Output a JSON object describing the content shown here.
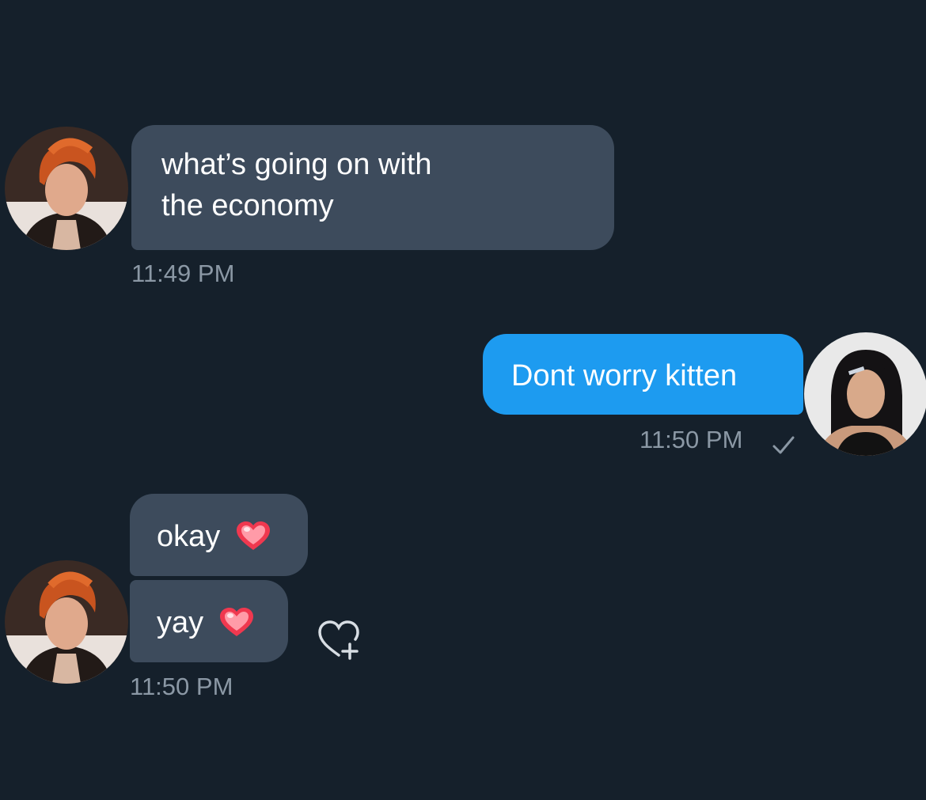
{
  "conversation": {
    "messages": [
      {
        "text": "what’s going on with\nthe economy",
        "time": "11:49 PM"
      },
      {
        "text": "Dont worry kitten",
        "time": "11:50 PM"
      },
      {
        "text": "okay",
        "emoji": "heart-emoji"
      },
      {
        "text": "yay",
        "emoji": "heart-emoji",
        "time": "11:50 PM"
      }
    ]
  },
  "colors": {
    "background": "#15202b",
    "incoming_bubble": "#3d4b5c",
    "outgoing_bubble": "#1d9bf0",
    "timestamp": "#8b98a5",
    "heart": "#f0384f"
  },
  "icons": {
    "sent_check": "check-icon",
    "add_reaction": "heart-plus-icon"
  }
}
